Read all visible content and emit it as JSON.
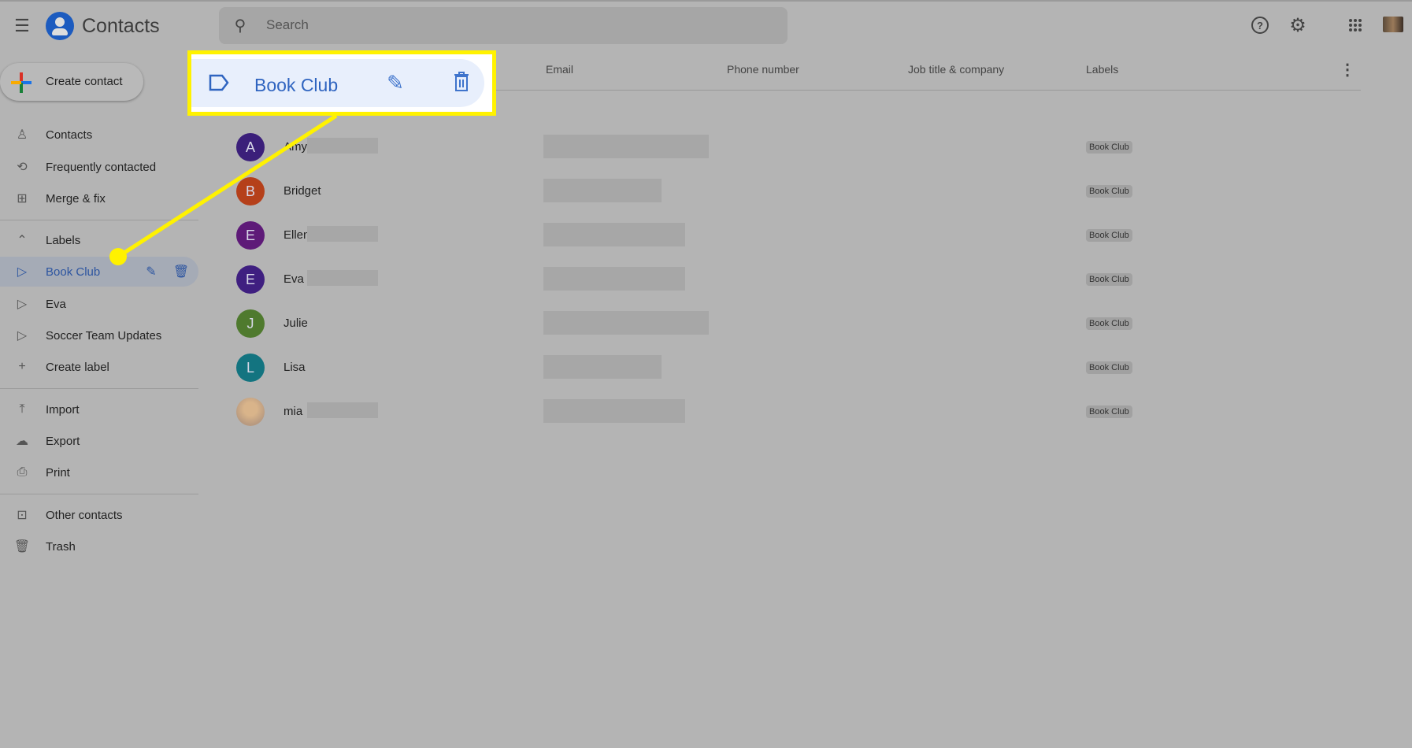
{
  "header": {
    "app_title": "Contacts",
    "search_placeholder": "Search",
    "icons": [
      "menu-icon",
      "contacts-logo",
      "search-icon",
      "help-icon",
      "settings-icon",
      "apps-icon",
      "account-avatar"
    ]
  },
  "sidebar": {
    "create_contact": "Create contact",
    "items": [
      {
        "label": "Contacts",
        "icon": "person-icon"
      },
      {
        "label": "Frequently contacted",
        "icon": "history-icon"
      },
      {
        "label": "Merge & fix",
        "icon": "merge-icon"
      }
    ],
    "labels_heading": "Labels",
    "labels": [
      {
        "label": "Book Club",
        "active": true
      },
      {
        "label": "Eva"
      },
      {
        "label": "Soccer Team Updates"
      }
    ],
    "create_label": "Create label",
    "tools": [
      {
        "label": "Import",
        "icon": "upload-icon"
      },
      {
        "label": "Export",
        "icon": "cloud-download-icon"
      },
      {
        "label": "Print",
        "icon": "print-icon"
      }
    ],
    "other": [
      {
        "label": "Other contacts",
        "icon": "other-contacts-icon"
      },
      {
        "label": "Trash",
        "icon": "trash-icon"
      }
    ]
  },
  "table": {
    "columns": [
      "Email",
      "Phone number",
      "Job title & company",
      "Labels"
    ],
    "rows": [
      {
        "initial": "A",
        "name": "Amy",
        "color": "#3b1f7a",
        "label": "Book Club"
      },
      {
        "initial": "B",
        "name": "Bridget",
        "color": "#b5401a",
        "label": "Book Club"
      },
      {
        "initial": "E",
        "name": "Ellen",
        "color": "#5e1a78",
        "label": "Book Club"
      },
      {
        "initial": "E",
        "name": "Eva",
        "color": "#3f1f80",
        "label": "Book Club"
      },
      {
        "initial": "J",
        "name": "Julie",
        "color": "#4f7a2e",
        "label": "Book Club"
      },
      {
        "initial": "L",
        "name": "Lisa",
        "color": "#137480",
        "label": "Book Club"
      },
      {
        "initial": "",
        "name": "mia",
        "color": "#c9a88a",
        "label": "Book Club"
      }
    ]
  },
  "callout": {
    "label": "Book Club",
    "highlight_color": "#fff200"
  }
}
